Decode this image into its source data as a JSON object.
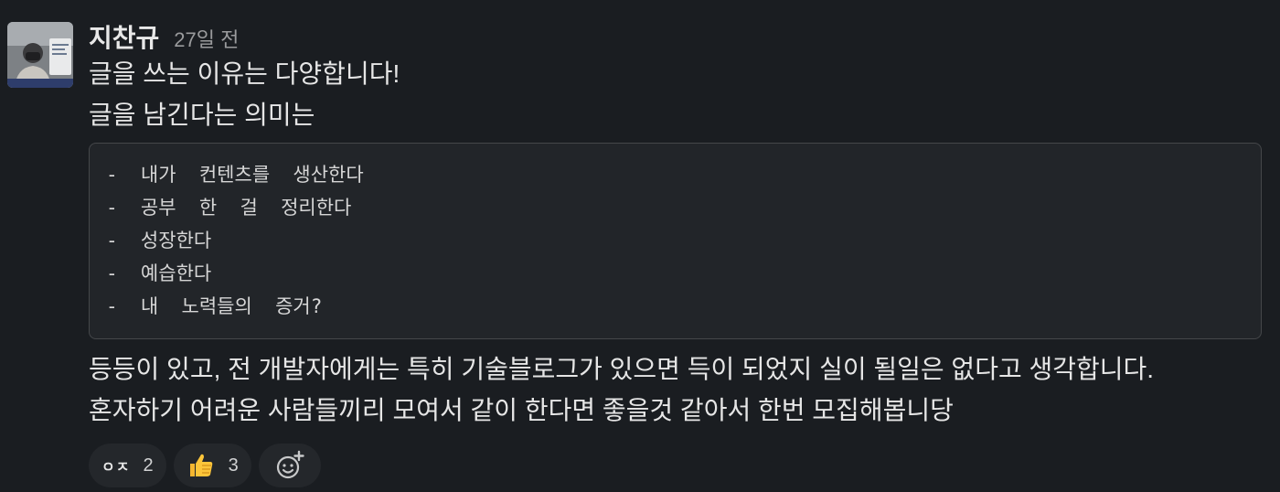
{
  "message": {
    "author": "지찬규",
    "timestamp": "27일 전",
    "lines": [
      "글을 쓰는 이유는 다양합니다!",
      "글을 남긴다는 의미는"
    ],
    "code_lines": [
      "-  내가  컨텐츠를  생산한다",
      "-  공부  한  걸  정리한다",
      "-  성장한다",
      "-  예습한다",
      "-  내  노력들의  증거?"
    ],
    "after_lines": [
      "등등이 있고, 전 개발자에게는 특히 기술블로그가 있으면 득이 되었지 실이 될일은 없다고 생각합니다.",
      "혼자하기 어려운 사람들끼리 모여서 같이 한다면 좋을것 같아서 한번 모집해봅니당"
    ]
  },
  "reactions": [
    {
      "emoji_text": "ㅇㅈ",
      "icon": "custom-text-emoji",
      "count": "2"
    },
    {
      "icon": "thumbs-up-icon",
      "count": "3"
    }
  ],
  "add_reaction": {
    "icon": "add-reaction-icon"
  }
}
